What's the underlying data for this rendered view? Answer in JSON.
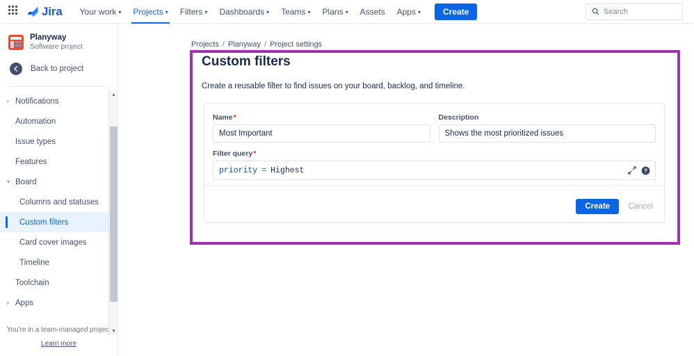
{
  "topnav": {
    "app_switcher": "app-switcher",
    "brand": "Jira",
    "items": [
      {
        "label": "Your work",
        "has_chevron": true,
        "active": false
      },
      {
        "label": "Projects",
        "has_chevron": true,
        "active": true
      },
      {
        "label": "Filters",
        "has_chevron": true,
        "active": false
      },
      {
        "label": "Dashboards",
        "has_chevron": true,
        "active": false
      },
      {
        "label": "Teams",
        "has_chevron": true,
        "active": false
      },
      {
        "label": "Plans",
        "has_chevron": true,
        "active": false
      },
      {
        "label": "Assets",
        "has_chevron": false,
        "active": false
      },
      {
        "label": "Apps",
        "has_chevron": true,
        "active": false
      }
    ],
    "create_label": "Create",
    "search_placeholder": "Search"
  },
  "sidebar": {
    "project_name": "Planyway",
    "project_type": "Software project",
    "back_label": "Back to project",
    "items": [
      {
        "label": "Notifications",
        "caret": "›",
        "sub": false,
        "selected": false
      },
      {
        "label": "Automation",
        "caret": "",
        "sub": false,
        "selected": false
      },
      {
        "label": "Issue types",
        "caret": "",
        "sub": false,
        "selected": false
      },
      {
        "label": "Features",
        "caret": "",
        "sub": false,
        "selected": false
      },
      {
        "label": "Board",
        "caret": "˅",
        "sub": false,
        "selected": false
      },
      {
        "label": "Columns and statuses",
        "caret": "",
        "sub": true,
        "selected": false
      },
      {
        "label": "Custom filters",
        "caret": "",
        "sub": true,
        "selected": true
      },
      {
        "label": "Card cover images",
        "caret": "",
        "sub": true,
        "selected": false
      },
      {
        "label": "Timeline",
        "caret": "",
        "sub": true,
        "selected": false
      },
      {
        "label": "Toolchain",
        "caret": "",
        "sub": false,
        "selected": false
      },
      {
        "label": "Apps",
        "caret": "›",
        "sub": false,
        "selected": false
      }
    ],
    "footer_note": "You're in a team-managed project",
    "footer_link": "Learn more"
  },
  "breadcrumb": {
    "item1": "Projects",
    "item2": "Planyway",
    "item3": "Project settings",
    "separator": "/"
  },
  "main": {
    "title": "Custom filters",
    "subtitle": "Create a reusable filter to find issues on your board, backlog, and timeline.",
    "form": {
      "name_label": "Name",
      "name_value": "Most Important",
      "description_label": "Description",
      "description_value": "Shows the most prioritized issues",
      "query_label": "Filter query",
      "query_field": "priority",
      "query_operator": "=",
      "query_value": "Highest",
      "required_marker": "*",
      "expand_icon": "expand-icon",
      "help_icon": "help-icon",
      "create_label": "Create",
      "cancel_label": "Cancel"
    }
  },
  "colors": {
    "brand_blue": "#0c66e4",
    "annotation_purple": "#a032b0",
    "project_avatar": "#e94f30",
    "required_red": "#de350b",
    "jql_field": "#0052cc",
    "jql_operator": "#00857a"
  }
}
